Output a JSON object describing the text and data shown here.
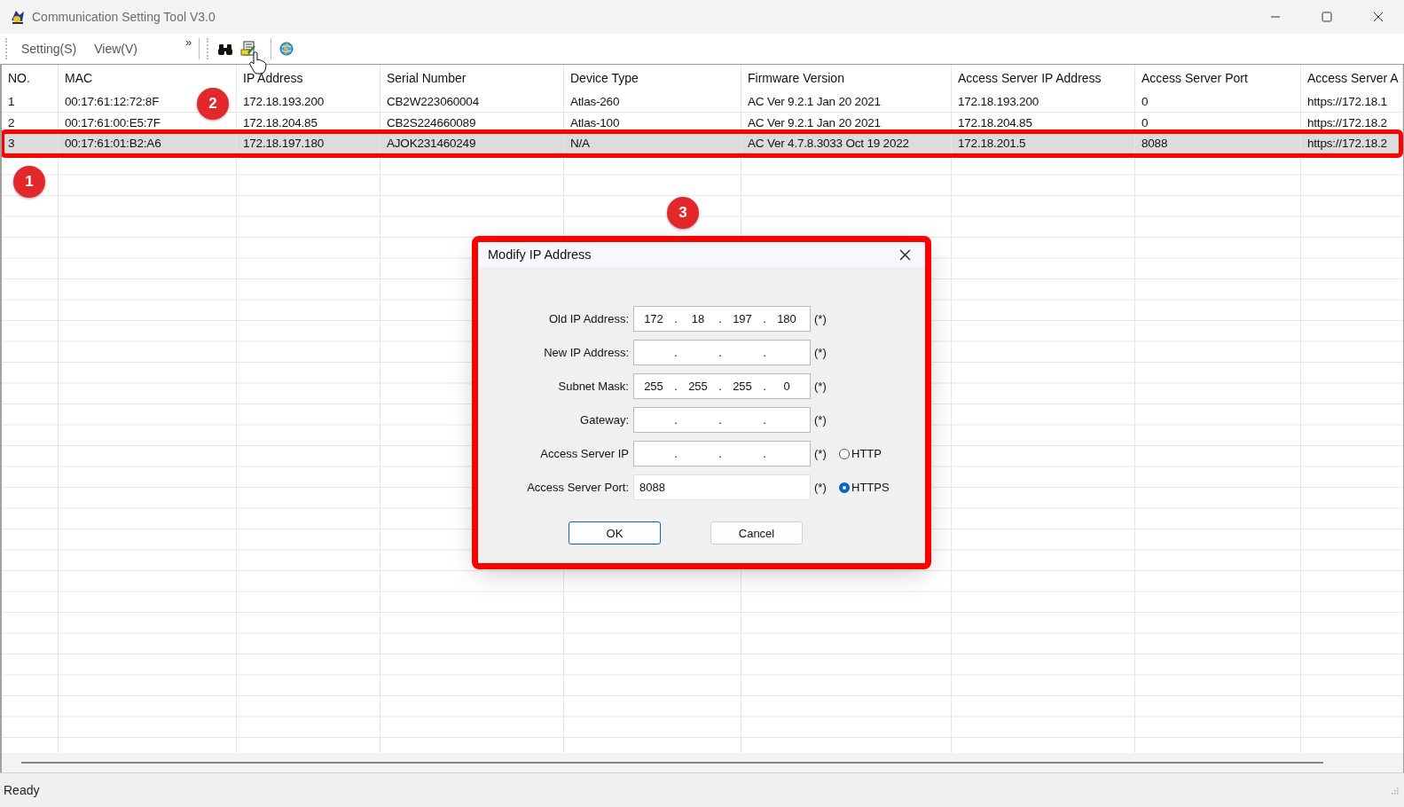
{
  "window": {
    "title": "Communication Setting Tool V3.0"
  },
  "menu": [
    {
      "label": "Setting(S)"
    },
    {
      "label": "View(V)"
    }
  ],
  "menu_overflow": "»",
  "table": {
    "columns": [
      "NO.",
      "MAC",
      "IP Address",
      "Serial Number",
      "Device Type",
      "Firmware Version",
      "Access Server IP Address",
      "Access Server Port",
      "Access Server A"
    ],
    "rows": [
      {
        "selected": false,
        "framed": false,
        "cells": [
          "1",
          "00:17:61:12:72:8F",
          "172.18.193.200",
          "CB2W223060004",
          "Atlas-260",
          "AC Ver 9.2.1 Jan 20 2021",
          "172.18.193.200",
          "0",
          "https://172.18.1"
        ]
      },
      {
        "selected": false,
        "framed": false,
        "cells": [
          "2",
          "00:17:61:00:E5:7F",
          "172.18.204.85",
          "CB2S224660089",
          "Atlas-100",
          "AC Ver 9.2.1 Jan 20 2021",
          "172.18.204.85",
          "0",
          "https://172.18.2"
        ]
      },
      {
        "selected": true,
        "framed": true,
        "cells": [
          "3",
          "00:17:61:01:B2:A6",
          "172.18.197.180",
          "AJOK231460249",
          "N/A",
          "AC Ver 4.7.8.3033 Oct 19 2022",
          "172.18.201.5",
          "8088",
          "https://172.18.2"
        ]
      }
    ]
  },
  "annotations": [
    "1",
    "2",
    "3"
  ],
  "dialog": {
    "title": "Modify IP Address",
    "framed": true,
    "fields": [
      {
        "kind": "ip",
        "label": "Old IP Address:",
        "octets": [
          "172",
          "18",
          "197",
          "180"
        ],
        "dots": [
          ".",
          ".",
          "."
        ],
        "required": "(*)"
      },
      {
        "kind": "ip",
        "label": "New IP Address:",
        "dots": [
          ".",
          ".",
          "."
        ],
        "required": "(*)"
      },
      {
        "kind": "ip",
        "label": "Subnet Mask:",
        "octets": [
          "255",
          "255",
          "255",
          "0"
        ],
        "dots": [
          ".",
          ".",
          "."
        ],
        "required": "(*)"
      },
      {
        "kind": "ip",
        "label": "Gateway:",
        "dots": [
          ".",
          ".",
          "."
        ],
        "required": "(*)"
      },
      {
        "kind": "ip",
        "label": "Access Server IP",
        "dots": [
          ".",
          ".",
          "."
        ],
        "required": "(*)",
        "radio": {
          "label": "HTTP",
          "selected": false
        }
      },
      {
        "kind": "text",
        "label": "Access Server Port:",
        "value": "8088",
        "required": "(*)",
        "radio": {
          "label": "HTTPS",
          "selected": true
        }
      }
    ],
    "buttons": [
      {
        "label": "OK",
        "default": true
      },
      {
        "label": "Cancel",
        "default": false
      }
    ]
  },
  "status_bar": "Ready"
}
